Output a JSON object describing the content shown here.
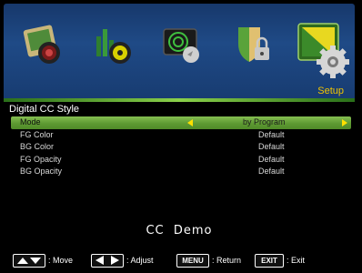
{
  "header": {
    "section_label": "Setup",
    "icons": [
      "picture-icon",
      "sound-icon",
      "channel-icon",
      "lock-icon",
      "setup-icon"
    ],
    "selected": "setup-icon"
  },
  "page": {
    "title": "Digital CC Style",
    "rows": [
      {
        "label": "Mode",
        "value": "by Program",
        "selected": true
      },
      {
        "label": "FG Color",
        "value": "Default",
        "selected": false
      },
      {
        "label": "BG Color",
        "value": "Default",
        "selected": false
      },
      {
        "label": "FG Opacity",
        "value": "Default",
        "selected": false
      },
      {
        "label": "BG Opacity",
        "value": "Default",
        "selected": false
      }
    ],
    "demo_text": "CC  Demo"
  },
  "hints": {
    "move": ": Move",
    "adjust": ": Adjust",
    "menu_key": "MENU",
    "return": ": Return",
    "exit_key": "EXIT",
    "exit": ": Exit"
  },
  "colors": {
    "selected_row": "#6aa63c",
    "section_label": "#f1c400",
    "arrow": "#ffe000"
  }
}
